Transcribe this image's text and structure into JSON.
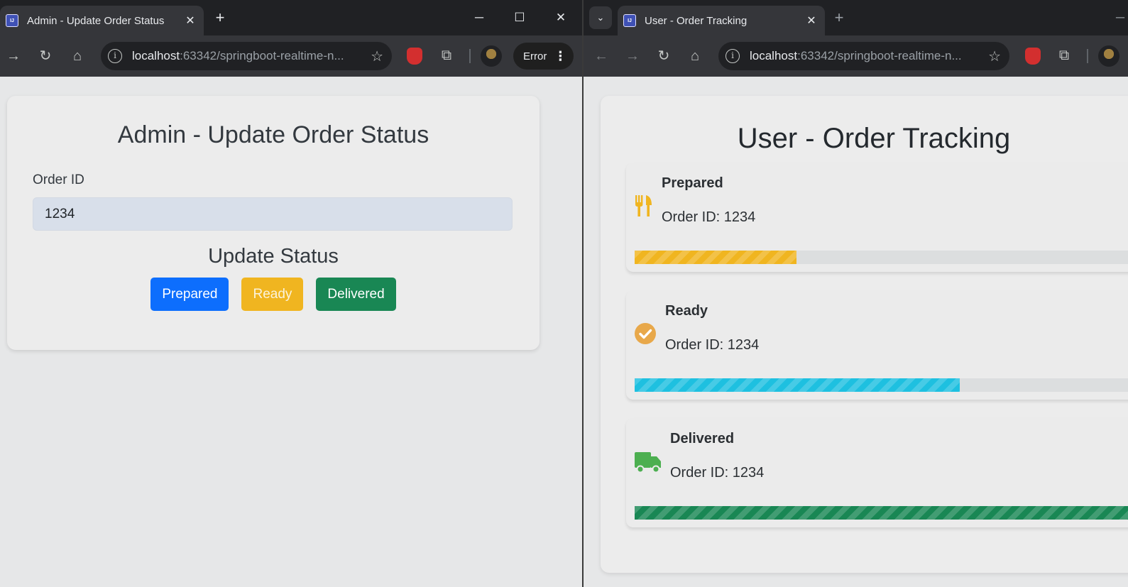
{
  "left_browser": {
    "tab_title": "Admin - Update Order Status",
    "url_host": "localhost",
    "url_path": ":63342/springboot-realtime-n...",
    "error_label": "Error"
  },
  "right_browser": {
    "tab_title": "User - Order Tracking",
    "url_host": "localhost",
    "url_path": ":63342/springboot-realtime-n..."
  },
  "admin": {
    "title": "Admin - Update Order Status",
    "order_id_label": "Order ID",
    "order_id_value": "1234",
    "update_heading": "Update Status",
    "buttons": {
      "prepared": "Prepared",
      "ready": "Ready",
      "delivered": "Delivered"
    }
  },
  "tracking": {
    "title": "User - Order Tracking",
    "statuses": [
      {
        "name": "Prepared",
        "order_id": "Order ID: 1234",
        "icon": "fork-knife-icon",
        "color": "#f0b520",
        "progress": 0.305
      },
      {
        "name": "Ready",
        "order_id": "Order ID: 1234",
        "icon": "check-circle-icon",
        "color": "#1ec0e0",
        "progress": 0.612
      },
      {
        "name": "Delivered",
        "order_id": "Order ID: 1234",
        "icon": "truck-icon",
        "color": "#198754",
        "progress": 1.0
      }
    ]
  },
  "colors": {
    "primary": "#0d6efd",
    "warning": "#f0b520",
    "success": "#198754",
    "info": "#1ec0e0"
  }
}
